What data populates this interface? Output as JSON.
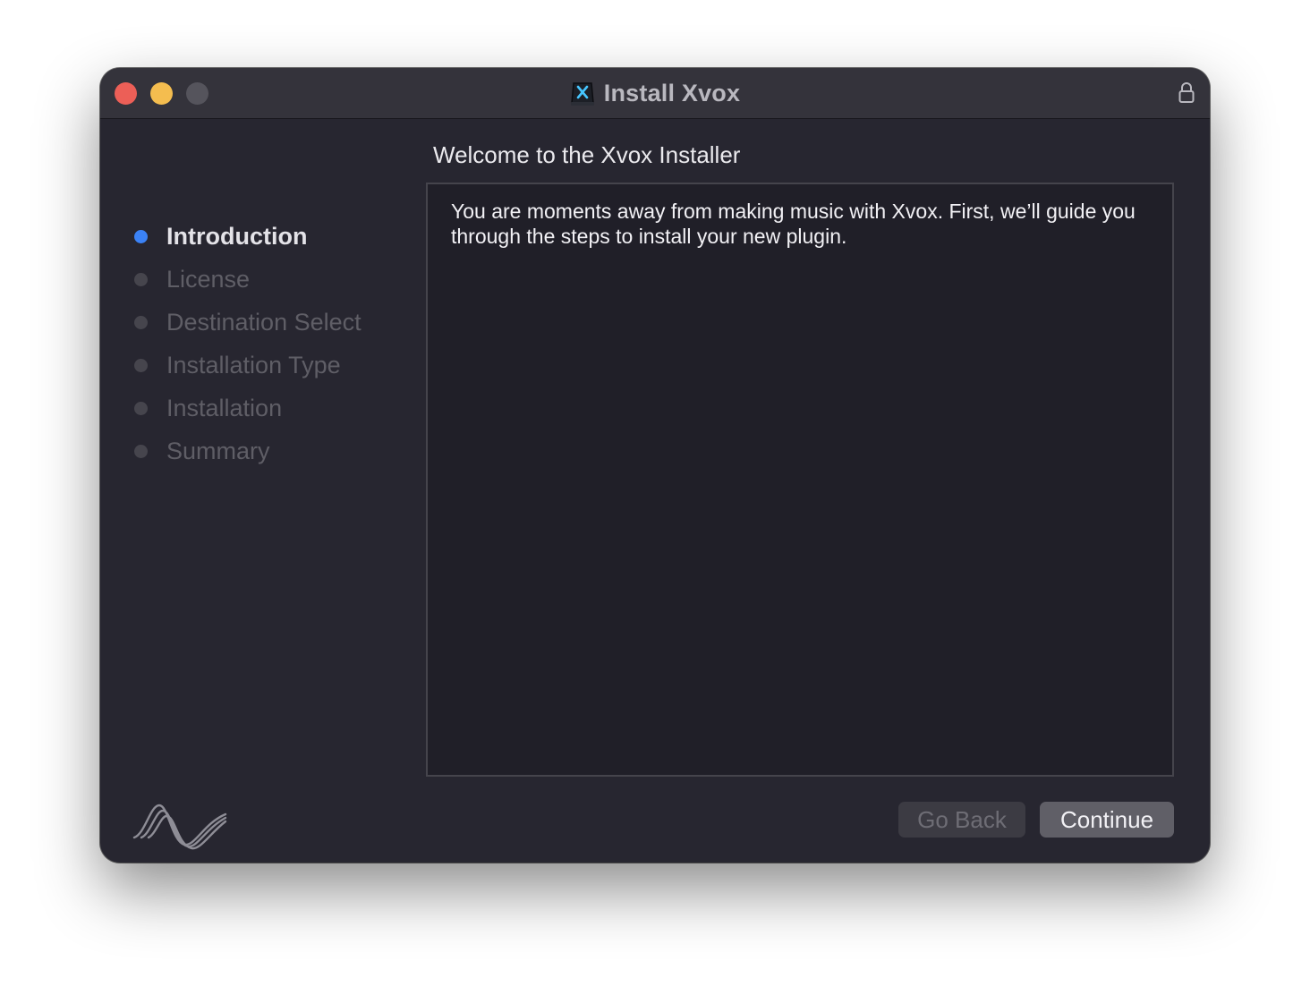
{
  "window": {
    "title": "Install Xvox"
  },
  "icons": {
    "app": "xvox-app-icon",
    "lock": "lock-icon",
    "logo": "wave-logo-icon"
  },
  "sidebar": {
    "items": [
      {
        "label": "Introduction",
        "active": true
      },
      {
        "label": "License",
        "active": false
      },
      {
        "label": "Destination Select",
        "active": false
      },
      {
        "label": "Installation Type",
        "active": false
      },
      {
        "label": "Installation",
        "active": false
      },
      {
        "label": "Summary",
        "active": false
      }
    ]
  },
  "main": {
    "heading": "Welcome to the Xvox Installer",
    "body": "You are moments away from making music with Xvox. First, we’ll guide you through the steps to install your new plugin."
  },
  "buttons": {
    "back": "Go Back",
    "continue": "Continue"
  },
  "colors": {
    "accent": "#3b82f6",
    "close": "#ec5f57",
    "minimize": "#f4bd4f",
    "zoom_disabled": "#55545c"
  }
}
